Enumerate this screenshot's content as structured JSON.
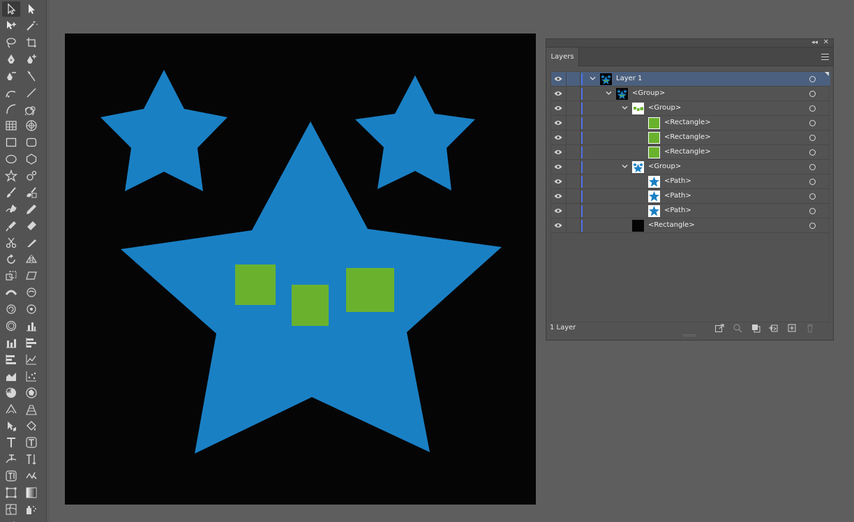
{
  "toolbar": {
    "tools": [
      {
        "name": "selection-tool-icon",
        "active": true
      },
      {
        "name": "direct-selection-tool-icon"
      },
      {
        "name": "group-selection-tool-icon"
      },
      {
        "name": "magic-wand-tool-icon"
      },
      {
        "name": "lasso-tool-icon"
      },
      {
        "name": "artboard-tool-icon"
      },
      {
        "name": "pen-tool-icon"
      },
      {
        "name": "add-anchor-point-tool-icon"
      },
      {
        "name": "delete-anchor-point-tool-icon"
      },
      {
        "name": "anchor-point-tool-icon"
      },
      {
        "name": "curvature-tool-icon"
      },
      {
        "name": "line-segment-tool-icon"
      },
      {
        "name": "arc-tool-icon"
      },
      {
        "name": "spiral-tool-icon"
      },
      {
        "name": "rectangular-grid-tool-icon"
      },
      {
        "name": "polar-grid-tool-icon"
      },
      {
        "name": "rectangle-tool-icon"
      },
      {
        "name": "rounded-rectangle-tool-icon"
      },
      {
        "name": "ellipse-tool-icon"
      },
      {
        "name": "polygon-tool-icon"
      },
      {
        "name": "star-tool-icon"
      },
      {
        "name": "flare-tool-icon"
      },
      {
        "name": "paintbrush-tool-icon"
      },
      {
        "name": "blob-brush-tool-icon"
      },
      {
        "name": "shaper-tool-icon"
      },
      {
        "name": "pencil-tool-icon"
      },
      {
        "name": "smooth-tool-icon"
      },
      {
        "name": "eraser-tool-icon"
      },
      {
        "name": "scissors-tool-icon"
      },
      {
        "name": "knife-tool-icon"
      },
      {
        "name": "rotate-tool-icon"
      },
      {
        "name": "reflect-tool-icon"
      },
      {
        "name": "scale-tool-icon"
      },
      {
        "name": "shear-tool-icon"
      },
      {
        "name": "width-tool-icon"
      },
      {
        "name": "warp-tool-icon"
      },
      {
        "name": "twirl-tool-icon"
      },
      {
        "name": "pucker-tool-icon"
      },
      {
        "name": "bloat-tool-icon"
      },
      {
        "name": "column-graph-tool-icon"
      },
      {
        "name": "stacked-column-graph-tool-icon"
      },
      {
        "name": "bar-graph-tool-icon"
      },
      {
        "name": "stacked-bar-graph-tool-icon"
      },
      {
        "name": "line-graph-tool-icon"
      },
      {
        "name": "area-graph-tool-icon"
      },
      {
        "name": "scatter-graph-tool-icon"
      },
      {
        "name": "pie-graph-tool-icon"
      },
      {
        "name": "radar-graph-tool-icon"
      },
      {
        "name": "mesh-tool-icon"
      },
      {
        "name": "perspective-grid-tool-icon"
      },
      {
        "name": "perspective-selection-tool-icon"
      },
      {
        "name": "live-paint-bucket-tool-icon"
      },
      {
        "name": "type-tool-icon"
      },
      {
        "name": "area-type-tool-icon"
      },
      {
        "name": "type-on-path-tool-icon"
      },
      {
        "name": "vertical-type-tool-icon"
      },
      {
        "name": "vertical-area-type-tool-icon"
      },
      {
        "name": "touch-type-tool-icon"
      },
      {
        "name": "free-transform-tool-icon"
      },
      {
        "name": "gradient-tool-icon"
      },
      {
        "name": "mesh-warp-tool-icon"
      },
      {
        "name": "symbol-sprayer-tool-icon"
      },
      {
        "name": "slice-tool-icon"
      },
      {
        "name": "slice-select-tool-icon"
      }
    ]
  },
  "artboard": {
    "background": "#050505",
    "star_color": "#1a80c4",
    "rect_color": "#6ab22e"
  },
  "layers_panel": {
    "tab_label": "Layers",
    "collapse_glyph": "◂◂",
    "close_glyph": "✕",
    "rows": [
      {
        "label": "Layer 1",
        "indent": 0,
        "expanded": true,
        "thumb": "group-stars",
        "selected": true
      },
      {
        "label": "<Group>",
        "indent": 1,
        "expanded": true,
        "thumb": "group-stars"
      },
      {
        "label": "<Group>",
        "indent": 2,
        "expanded": true,
        "thumb": "group-rects"
      },
      {
        "label": "<Rectangle>",
        "indent": 3,
        "thumb": "green-rect"
      },
      {
        "label": "<Rectangle>",
        "indent": 3,
        "thumb": "green-rect"
      },
      {
        "label": "<Rectangle>",
        "indent": 3,
        "thumb": "green-rect"
      },
      {
        "label": "<Group>",
        "indent": 2,
        "expanded": true,
        "thumb": "group-stars-white"
      },
      {
        "label": "<Path>",
        "indent": 3,
        "thumb": "star-path"
      },
      {
        "label": "<Path>",
        "indent": 3,
        "thumb": "star-path"
      },
      {
        "label": "<Path>",
        "indent": 3,
        "thumb": "star-path"
      },
      {
        "label": "<Rectangle>",
        "indent": 2,
        "thumb": "black-rect"
      }
    ],
    "footer": {
      "layer_count": "1 Layer",
      "icons": [
        "export-for-screens-icon",
        "locate-object-icon",
        "make-clipping-mask-icon",
        "create-sublayer-icon",
        "create-new-layer-icon",
        "delete-layer-icon"
      ]
    }
  }
}
